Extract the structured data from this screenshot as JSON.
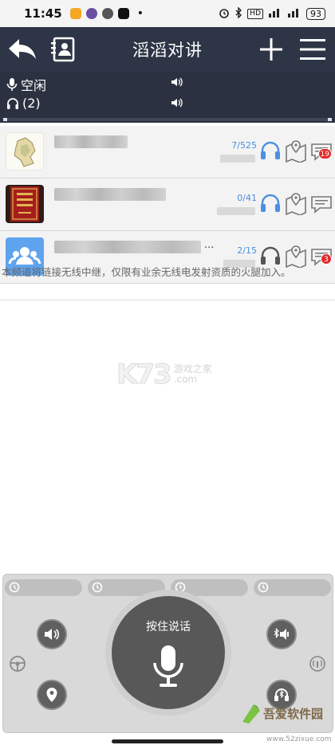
{
  "status_bar": {
    "time": "11:45",
    "dot": "•",
    "icons": [
      "alarm-icon",
      "bluetooth-icon",
      "hd-icon",
      "signal-icon",
      "signal-icon"
    ],
    "hd_label": "HD",
    "battery": "93"
  },
  "appbar": {
    "title": "滔滔对讲",
    "icons": [
      "back-arrow-icon",
      "contacts-icon",
      "plus-icon",
      "menu-icon"
    ]
  },
  "strip": {
    "mic_status": "空闲",
    "listener_count": "(2)"
  },
  "channels": [
    {
      "count": "7/525",
      "badge": "19",
      "avatar": "map-avatar",
      "headphone_color": "#4a90e2"
    },
    {
      "count": "0/41",
      "badge": "",
      "avatar": "banner-avatar",
      "headphone_color": "#4a90e2"
    },
    {
      "count": "2/15",
      "badge": "3",
      "avatar": "group-avatar",
      "headphone_color": "#555555"
    }
  ],
  "third_row_ellipsis": "...",
  "notice": "本频道将链接无线中继，仅限有业余无线电发射资质的火腿加入。",
  "watermark": {
    "logo": "K73",
    "line1": "游戏之家",
    "line2": ".com"
  },
  "panel": {
    "ptt_label": "按住说话",
    "history_icon": "history-icon"
  },
  "brand": {
    "name": "吾爱软件园",
    "url": "www.52zixue.com"
  },
  "colors": {
    "appbar": "#2d3546",
    "accent": "#4a90e2",
    "badge": "#e02a2a",
    "ptt": "#585858"
  }
}
